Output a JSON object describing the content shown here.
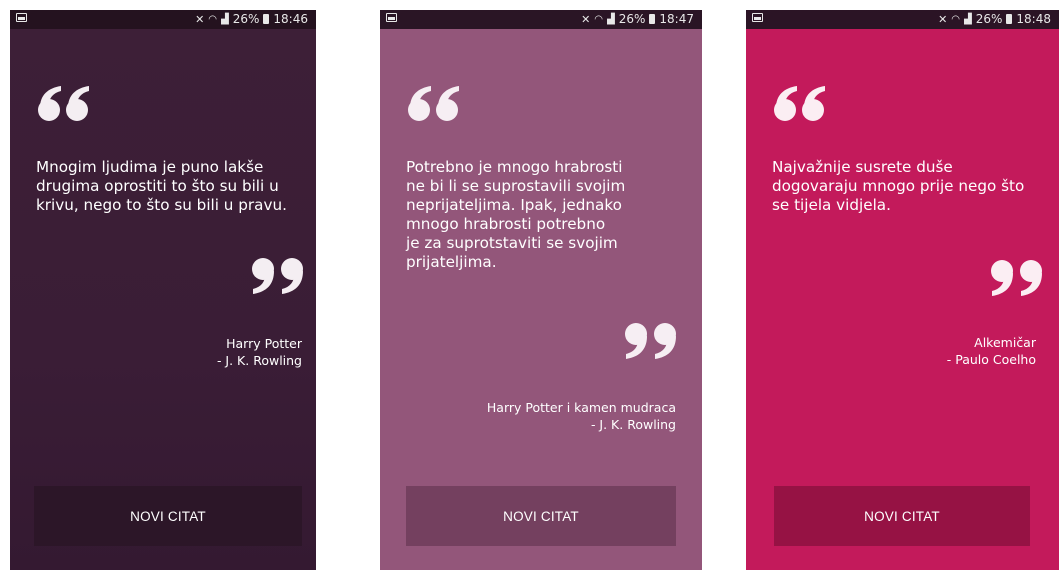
{
  "screens": [
    {
      "status": {
        "time": "18:46",
        "battery": "26%"
      },
      "quote": "Mnogim ljudima je puno lakše\ndrugima oprostiti to što su bili u\nkrivu, nego to što su bili u pravu.",
      "source": "Harry Potter",
      "author": "- J. K. Rowling",
      "button_label": "NOVI CITAT",
      "bg_color": "#3b1e36",
      "button_color": "#2c1628"
    },
    {
      "status": {
        "time": "18:47",
        "battery": "26%"
      },
      "quote": "Potrebno je mnogo hrabrosti\nne bi li se suprostavili svojim\nneprijateljima. Ipak, jednako\nmnogo hrabrosti  potrebno\nje za suprotstaviti se svojim\nprijateljima.",
      "source": "Harry Potter i kamen mudraca",
      "author": "- J. K. Rowling",
      "button_label": "NOVI CITAT",
      "bg_color": "#93567a",
      "button_color": "#74405f"
    },
    {
      "status": {
        "time": "18:48",
        "battery": "26%"
      },
      "quote": "Najvažnije susrete duše\ndogovaraju mnogo prije nego što\nse tijela vidjela.",
      "source": "Alkemičar",
      "author": "- Paulo Coelho",
      "button_label": "NOVI CITAT",
      "bg_color": "#c31a5b",
      "button_color": "#961244"
    }
  ]
}
